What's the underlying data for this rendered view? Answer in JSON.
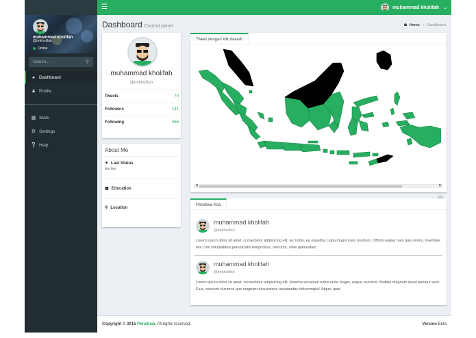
{
  "topbar": {
    "menu_icon": "hamburger-icon",
    "user_name": "muhammad kholifah",
    "color": "#27ae60"
  },
  "sidebar": {
    "user_name": "muhammad kholifah",
    "user_handle": "@tmkholifah",
    "status": "Online",
    "search_placeholder": "Search...",
    "items": [
      {
        "label": "Dashboard",
        "icon": "dashboard-icon",
        "active": true
      },
      {
        "label": "Profile",
        "icon": "user-icon"
      },
      {
        "label": "Stats",
        "icon": "bar-chart-icon"
      },
      {
        "label": "Settings",
        "icon": "gear-icon"
      },
      {
        "label": "Help",
        "icon": "question-icon"
      }
    ]
  },
  "header": {
    "title": "Dashboard",
    "subtitle": "Control panel",
    "breadcrumb_home": "Home",
    "breadcrumb_current": "Dashboard"
  },
  "profile": {
    "name": "muhammad kholifah",
    "handle": "@tmkholifah",
    "stats": [
      {
        "label": "Tweets",
        "value": "70"
      },
      {
        "label": "Followers",
        "value": "141"
      },
      {
        "label": "Following",
        "value": "366"
      }
    ]
  },
  "about": {
    "title": "About Me",
    "sections": [
      {
        "label": "Last Status",
        "icon": "twitter-icon",
        "value": "tes tes"
      },
      {
        "label": "Education",
        "icon": "book-icon",
        "value": ""
      },
      {
        "label": "Location",
        "icon": "map-marker-icon",
        "value": ""
      }
    ]
  },
  "map": {
    "tab_label": "Tweet dengan klik daerah",
    "fill_color": "#27ae60",
    "highlight_color": "#000000"
  },
  "feed": {
    "tab_label": "Peristiwa Kita",
    "posts": [
      {
        "name": "muhammad kholifah",
        "handle": "@tmkholifah",
        "text": "Lorem ipsum dolor sit amet, consectetur adipisicing elit. Ex nobis, ea expedita culpa magni iusto nostrum. Officiis eaque nam quis omnis, inventore iste cum voluptatibus perspiciatis temporibus, nesciunt, vitae quibusdam."
      },
      {
        "name": "muhammad kholifah",
        "handle": "@tmkholifah",
        "text": "Lorem ipsum dolor sit amet, consectetur adipisicing elit. Maxime excepturi nobis unde magni, eaque nesciunt. Mollitia magnam quasi pariatur vero. Eius, nesciunt ducimus quo magnam accusamus recusandae doloremque! Atque, ipsa."
      }
    ]
  },
  "footer": {
    "copyright_prefix": "Copyright © 2015",
    "brand": "Peristiwa.",
    "rights": "All rights reserved.",
    "version_label": "Version",
    "version_value": "Beta"
  }
}
